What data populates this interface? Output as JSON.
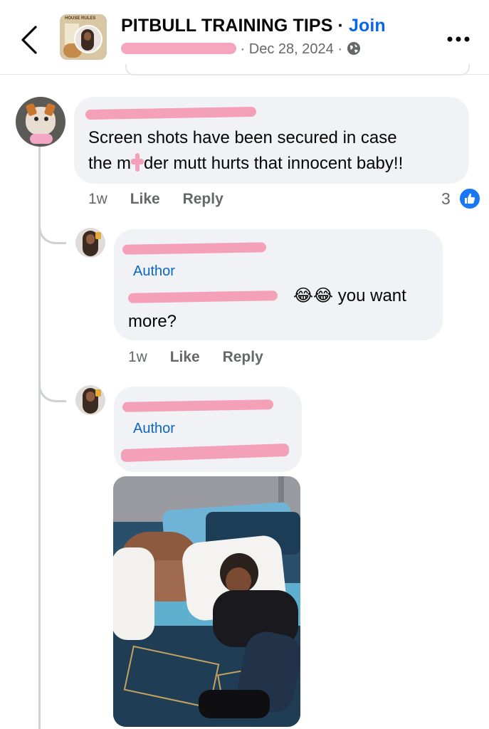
{
  "header": {
    "group_title": "PITBULL TRAINING TIPS",
    "separator": " · ",
    "join_label": "Join",
    "date": "Dec 28, 2024",
    "thumb_caption": "HOUSE RULES"
  },
  "comments": [
    {
      "text_line1": "Screen shots have been secured in case",
      "text_line2_a": "the m",
      "text_line2_b": "der mutt hurts that innocent baby!!",
      "time": "1w",
      "like_label": "Like",
      "reply_label": "Reply",
      "reaction_count": "3"
    },
    {
      "author_badge": "Author",
      "text_end": "😂😂 you want",
      "text_line2": "more?",
      "time": "1w",
      "like_label": "Like",
      "reply_label": "Reply"
    },
    {
      "author_badge": "Author"
    }
  ],
  "icons": {
    "back": "chevron-left-icon",
    "more": "more-dots-icon",
    "globe": "globe-icon",
    "like": "thumbs-up-icon"
  },
  "colors": {
    "accent": "#0a66e8",
    "bubble": "#f0f2f5",
    "redaction": "#f4a0b9",
    "like_badge": "#1877f2"
  }
}
